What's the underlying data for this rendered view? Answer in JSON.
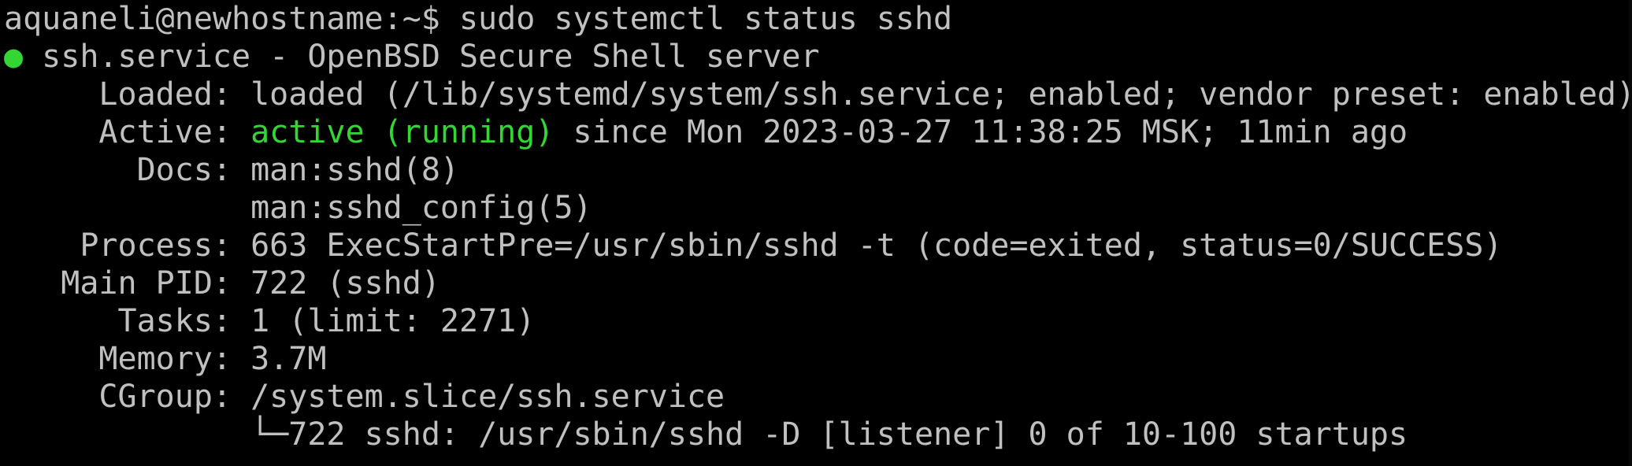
{
  "terminal": {
    "prompt": "aquaneli@newhostname:~$ ",
    "command": "sudo systemctl status sshd",
    "status_dot": "●",
    "service_line": " ssh.service - OpenBSD Secure Shell server",
    "loaded_label": "     Loaded: ",
    "loaded_value": "loaded (/lib/systemd/system/ssh.service; enabled; vendor preset: enabled)",
    "active_label": "     Active: ",
    "active_state": "active (running)",
    "active_since": " since Mon 2023-03-27 11:38:25 MSK; 11min ago",
    "docs_label": "       Docs: ",
    "docs_value_1": "man:sshd(8)",
    "docs_indent": "             ",
    "docs_value_2": "man:sshd_config(5)",
    "process_label": "    Process: ",
    "process_value": "663 ExecStartPre=/usr/sbin/sshd -t (code=exited, status=0/SUCCESS)",
    "mainpid_label": "   Main PID: ",
    "mainpid_value": "722 (sshd)",
    "tasks_label": "      Tasks: ",
    "tasks_value": "1 (limit: 2271)",
    "memory_label": "     Memory: ",
    "memory_value": "3.7M",
    "cgroup_label": "     CGroup: ",
    "cgroup_value": "/system.slice/ssh.service",
    "cgroup_child_indent": "             ",
    "cgroup_child": "└─722 sshd: /usr/sbin/sshd -D [listener] 0 of 10-100 startups"
  },
  "colors": {
    "background": "#000000",
    "foreground": "#c0c0c0",
    "active_green": "#33d633"
  }
}
